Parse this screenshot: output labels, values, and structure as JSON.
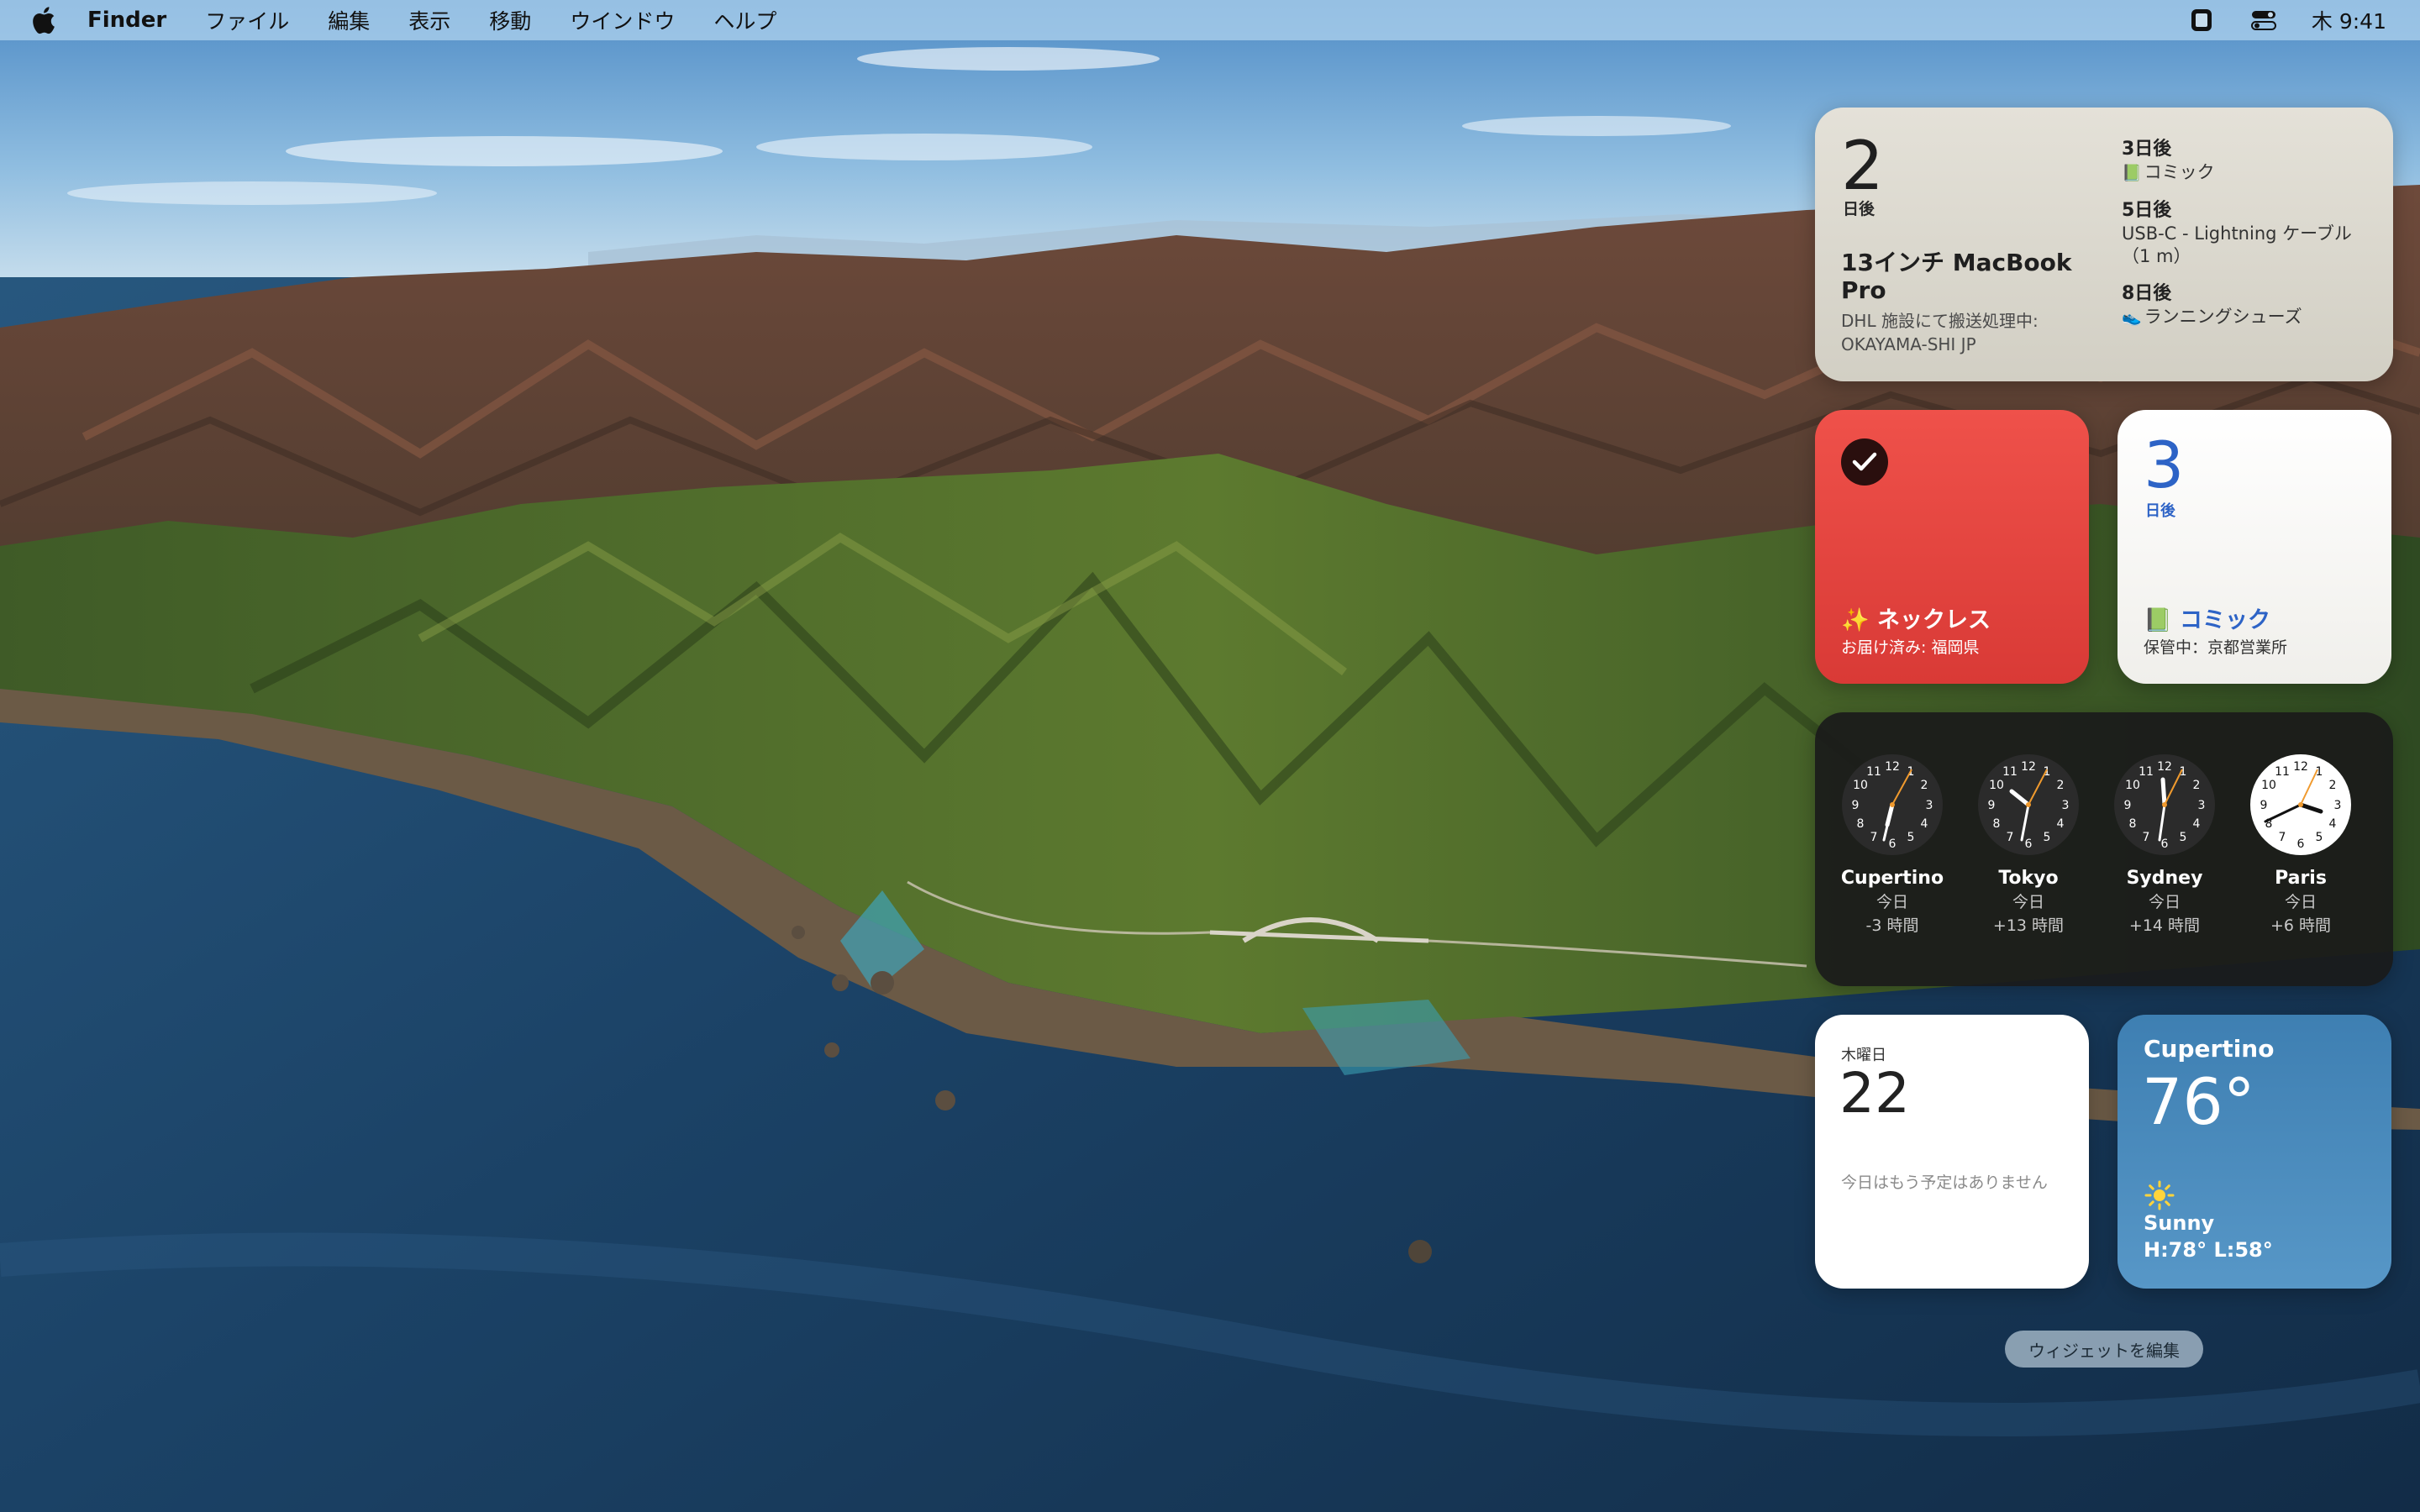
{
  "menubar": {
    "app_name": "Finder",
    "menus": [
      "ファイル",
      "編集",
      "表示",
      "移動",
      "ウインドウ",
      "ヘルプ"
    ],
    "clock": "木 9:41"
  },
  "tracking_large": {
    "days": "2",
    "days_unit": "日後",
    "package_title": "13インチ MacBook Pro",
    "package_status": "DHL 施設にて搬送処理中: OKAYAMA-SHI JP",
    "timeline": [
      {
        "days": "3日後",
        "emoji": "📗",
        "item": "コミック"
      },
      {
        "days": "5日後",
        "emoji": "",
        "item": "USB-C - Lightning ケーブル（1 m）"
      },
      {
        "days": "8日後",
        "emoji": "👟",
        "item": "ランニングシューズ"
      }
    ]
  },
  "delivered": {
    "title": "✨ ネックレス",
    "subtitle": "お届け済み: 福岡県"
  },
  "tracking_small": {
    "days": "3",
    "days_unit": "日後",
    "title": "📗 コミック",
    "subtitle": "保管中：京都営業所"
  },
  "world_clock": [
    {
      "city": "Cupertino",
      "day": "今日",
      "offset": "-3 時間"
    },
    {
      "city": "Tokyo",
      "day": "今日",
      "offset": "+13 時間"
    },
    {
      "city": "Sydney",
      "day": "今日",
      "offset": "+14 時間"
    },
    {
      "city": "Paris",
      "day": "今日",
      "offset": "+6 時間"
    }
  ],
  "calendar": {
    "weekday": "木曜日",
    "day": "22",
    "note": "今日はもう予定はありません"
  },
  "weather": {
    "city": "Cupertino",
    "temp": "76°",
    "condition": "Sunny",
    "hilo": "H:78° L:58°"
  },
  "edit_widgets_label": "ウィジェットを編集"
}
